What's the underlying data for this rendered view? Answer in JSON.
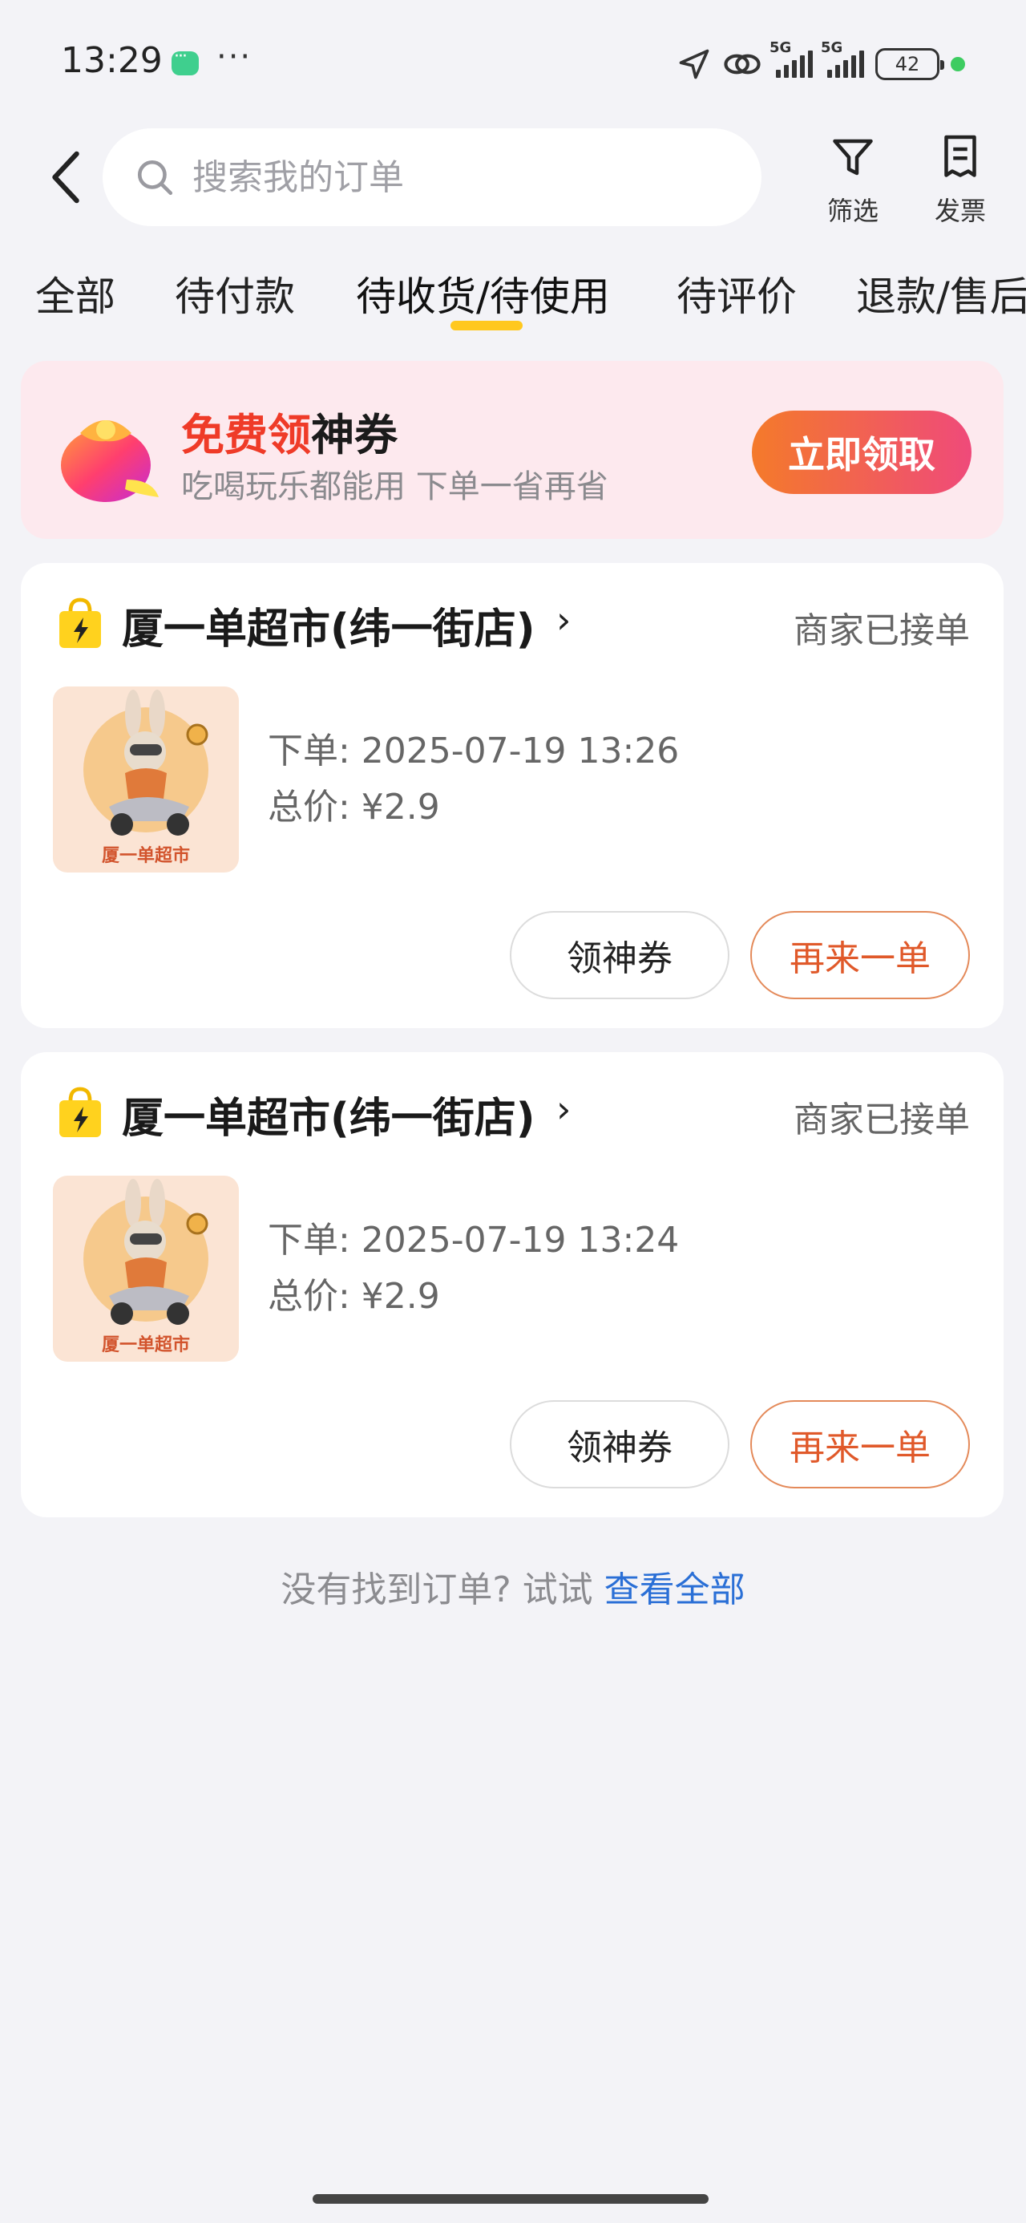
{
  "status_bar": {
    "time": "13:29",
    "network_1": "5G",
    "network_2": "5G",
    "battery": "42"
  },
  "header": {
    "search_placeholder": "搜索我的订单",
    "filter_label": "筛选",
    "invoice_label": "发票"
  },
  "tabs": [
    {
      "label": "全部"
    },
    {
      "label": "待付款"
    },
    {
      "label": "待收货/待使用"
    },
    {
      "label": "待评价"
    },
    {
      "label": "退款/售后"
    }
  ],
  "active_tab_index": 2,
  "promo": {
    "title_red": "免费领",
    "title_dark": "神券",
    "subtitle": "吃喝玩乐都能用 下单一省再省",
    "button": "立即领取"
  },
  "orders": [
    {
      "shop": "厦一单超市(纬一街店)",
      "status": "商家已接单",
      "thumb_text": "厦一单超市",
      "order_time": "下单: 2025-07-19 13:26",
      "total": "总价: ¥2.9",
      "coupon_btn": "领神券",
      "reorder_btn": "再来一单"
    },
    {
      "shop": "厦一单超市(纬一街店)",
      "status": "商家已接单",
      "thumb_text": "厦一单超市",
      "order_time": "下单: 2025-07-19 13:24",
      "total": "总价: ¥2.9",
      "coupon_btn": "领神券",
      "reorder_btn": "再来一单"
    }
  ],
  "footer_hint": {
    "text": "没有找到订单? 试试 ",
    "link": "查看全部"
  },
  "colors": {
    "accent_orange": "#e0592a",
    "tab_indicator": "#ffc81e",
    "link_blue": "#2a6fd6"
  }
}
